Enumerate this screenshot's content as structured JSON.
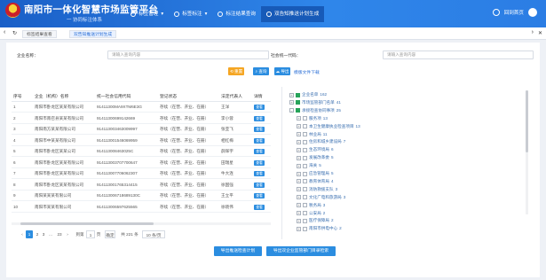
{
  "header": {
    "title": "南阳市一体化智慧市场监管平台",
    "subtitle": "一 协同标注体系",
    "nav": [
      {
        "label": "标签管理",
        "active": false,
        "has_arrow": true
      },
      {
        "label": "标签标注",
        "active": false,
        "has_arrow": true
      },
      {
        "label": "标注结果查询",
        "active": false,
        "has_arrow": false
      },
      {
        "label": "双告知推送计划生成",
        "active": true,
        "has_arrow": false
      }
    ],
    "home_label": "回到首页",
    "colors": {
      "header_start": "#1a5fc7",
      "header_end": "#2b7de4",
      "active_nav": "#175ab8",
      "primary": "#2b8de0",
      "warning": "#f5a623"
    }
  },
  "tabs": [
    {
      "label": "标签结果查看",
      "active": false
    },
    {
      "label": "双告知推送计划生成",
      "active": true
    }
  ],
  "filters": {
    "company_label": "企业名称：",
    "company_placeholder": "请输入查询内容",
    "credit_label": "社会统一代码：",
    "credit_placeholder": "请输入查询内容"
  },
  "buttons": {
    "reset": "重置",
    "search": "查询",
    "export": "导出",
    "download_template": "模版文件下载",
    "export_plan": "导出推送检查计划",
    "export_dept": "导出双企业监管部门目录检索"
  },
  "table": {
    "headers": [
      "序号",
      "企业（机构）名称",
      "统一社会信用代码",
      "登记状态",
      "法定代表人",
      "详情"
    ],
    "view_label": "查看",
    "rows": [
      [
        "1",
        "南阳市卧龙区某某有限公司",
        "91411300MA9XTM6E3G",
        "存续（在营、开业、在册）",
        "王洋"
      ],
      [
        "2",
        "南阳市南召县某某有限公司",
        "91411300699142669",
        "存续（在营、开业、在册）",
        "李小蓉"
      ],
      [
        "3",
        "南阳南方某某有限公司",
        "914113003463009997",
        "存续（在营、开业、在册）",
        "张亚飞"
      ],
      [
        "4",
        "南阳市中某某有限公司",
        "914113001546069959",
        "存续（在营、开业、在册）",
        "相红梅"
      ],
      [
        "5",
        "南阳市卧龙区某某公司",
        "914113008463025C",
        "存续（在营、开业、在册）",
        "薛辉宇"
      ],
      [
        "6",
        "南阳市卧龙区某某有限公司",
        "914113003707700647",
        "存续（在营、开业、在册）",
        "田瑞星"
      ],
      [
        "7",
        "南阳市卧龙区某某有限公司",
        "914113007706062307",
        "存续（在营、开业、在册）",
        "牛大连"
      ],
      [
        "8",
        "南阳市卧龙区某某有限公司",
        "914113001765314415",
        "存续（在营、开业、在册）",
        "徐国强"
      ],
      [
        "9",
        "南阳某某某有限公司",
        "914113006718689130C",
        "存续（在营、开业、在册）",
        "王立平"
      ],
      [
        "10",
        "南阳市某某有限公司",
        "914113006597625565",
        "存续（在营、开业、在册）",
        "徐晓伟"
      ]
    ]
  },
  "pager": {
    "pages": [
      "1",
      "2",
      "3",
      "..."
    ],
    "last_page": "23",
    "goto_label": "到第",
    "goto_value": "1",
    "page_unit": "页",
    "confirm": "确定",
    "total": "共 221 条",
    "page_size": "10 条/页"
  },
  "tree": [
    {
      "label": "企业名单",
      "count": "162",
      "expand": "+",
      "checked": true
    },
    {
      "label": "市场监管部门名单",
      "count": "41",
      "expand": "+",
      "checked": true
    },
    {
      "label": "承接检查协同事项",
      "count": "25",
      "expand": "-",
      "checked": true
    },
    {
      "label": "服务项",
      "count": "13",
      "expand": "+",
      "checked": false
    },
    {
      "label": "本卫生健康执业检查项目",
      "count": "13",
      "expand": "+",
      "checked": false
    },
    {
      "label": "林业局",
      "count": "11",
      "expand": "+",
      "checked": false
    },
    {
      "label": "住房和城乡建设局",
      "count": "7",
      "expand": "+",
      "checked": false
    },
    {
      "label": "生态环境局",
      "count": "6",
      "expand": "+",
      "checked": false
    },
    {
      "label": "发展改革委",
      "count": "5",
      "expand": "+",
      "checked": false
    },
    {
      "label": "海关",
      "count": "5",
      "expand": "+",
      "checked": false
    },
    {
      "label": "应急管理局",
      "count": "5",
      "expand": "+",
      "checked": false
    },
    {
      "label": "教育体育局",
      "count": "4",
      "expand": "+",
      "checked": false
    },
    {
      "label": "消防救援支队",
      "count": "3",
      "expand": "+",
      "checked": false
    },
    {
      "label": "文化广电和旅游局",
      "count": "3",
      "expand": "+",
      "checked": false
    },
    {
      "label": "税务局",
      "count": "3",
      "expand": "+",
      "checked": false
    },
    {
      "label": "公安局",
      "count": "2",
      "expand": "+",
      "checked": false
    },
    {
      "label": "医疗保障局",
      "count": "2",
      "expand": "+",
      "checked": false
    },
    {
      "label": "南阳市供电中心",
      "count": "2",
      "expand": "+",
      "checked": false
    }
  ]
}
